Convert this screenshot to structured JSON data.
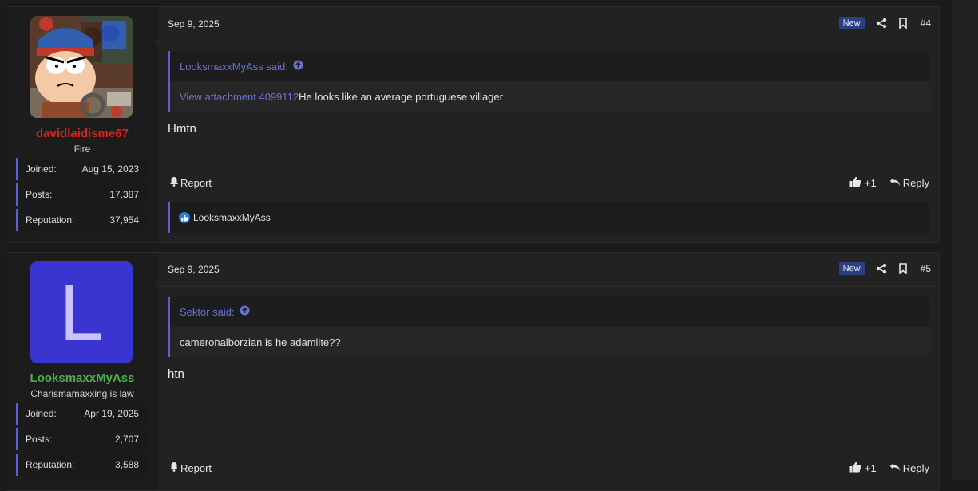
{
  "colors": {
    "accent": "#5b5fd4",
    "link": "#6b72d6",
    "username_red": "#e0201d",
    "username_green": "#4caf50",
    "badge_bg": "#2c3f80"
  },
  "posts": [
    {
      "username": "davidlaidisme67",
      "user_title": "Fire",
      "avatar_icon": "cartoon-avatar-image",
      "stats": [
        {
          "label": "Joined:",
          "value": "Aug 15, 2023"
        },
        {
          "label": "Posts:",
          "value": "17,387"
        },
        {
          "label": "Reputation:",
          "value": "37,954"
        }
      ],
      "date": "Sep 9, 2025",
      "badge": "New",
      "post_number": "#4",
      "quote": {
        "author_said": "LooksmaxxMyAss said:",
        "attachment_link": "View attachment 4099112",
        "text": "He looks like an average portuguese villager"
      },
      "message": "Hmtn",
      "report_label": "Report",
      "like_count": "+1",
      "reply_label": "Reply",
      "reactions": "LooksmaxxMyAss"
    },
    {
      "username": "LooksmaxxMyAss",
      "user_title": "Charismamaxxing is law",
      "avatar_letter": "L",
      "stats": [
        {
          "label": "Joined:",
          "value": "Apr 19, 2025"
        },
        {
          "label": "Posts:",
          "value": "2,707"
        },
        {
          "label": "Reputation:",
          "value": "3,588"
        }
      ],
      "date": "Sep 9, 2025",
      "badge": "New",
      "post_number": "#5",
      "quote": {
        "author_said": "Sektor said:",
        "text": "cameronalborzian is he adamlite??"
      },
      "message": "htn",
      "report_label": "Report",
      "like_count": "+1",
      "reply_label": "Reply"
    }
  ]
}
